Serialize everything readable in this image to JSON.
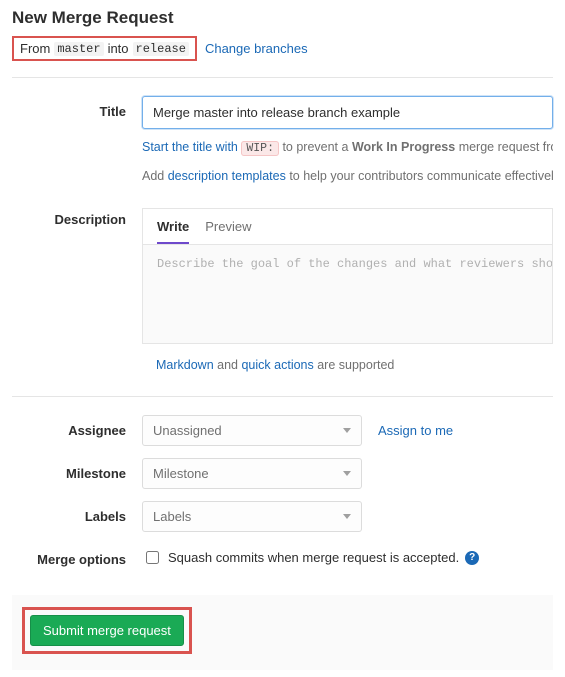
{
  "header": {
    "title": "New Merge Request"
  },
  "branches": {
    "prefix": "From",
    "source": "master",
    "mid": "into",
    "target": "release",
    "change_link": "Change branches"
  },
  "title": {
    "label": "Title",
    "value": "Merge master into release branch example",
    "hint_pre": "Start the title with ",
    "hint_wip": "WIP:",
    "hint_mid": " to prevent a ",
    "hint_bold": "Work In Progress",
    "hint_post": " merge request from be",
    "hint_line2_pre": "Add ",
    "hint_line2_link": "description templates",
    "hint_line2_post": " to help your contributors communicate effectively!"
  },
  "description": {
    "label": "Description",
    "tab_write": "Write",
    "tab_preview": "Preview",
    "placeholder": "Describe the goal of the changes and what reviewers should be ",
    "footer_pre": "",
    "footer_md": "Markdown",
    "footer_and": " and ",
    "footer_qa": "quick actions",
    "footer_post": " are supported"
  },
  "assignee": {
    "label": "Assignee",
    "placeholder": "Unassigned",
    "assign_me": "Assign to me"
  },
  "milestone": {
    "label": "Milestone",
    "placeholder": "Milestone"
  },
  "labels": {
    "label": "Labels",
    "placeholder": "Labels"
  },
  "merge_options": {
    "label": "Merge options",
    "squash_label": "Squash commits when merge request is accepted."
  },
  "submit": {
    "label": "Submit merge request"
  }
}
